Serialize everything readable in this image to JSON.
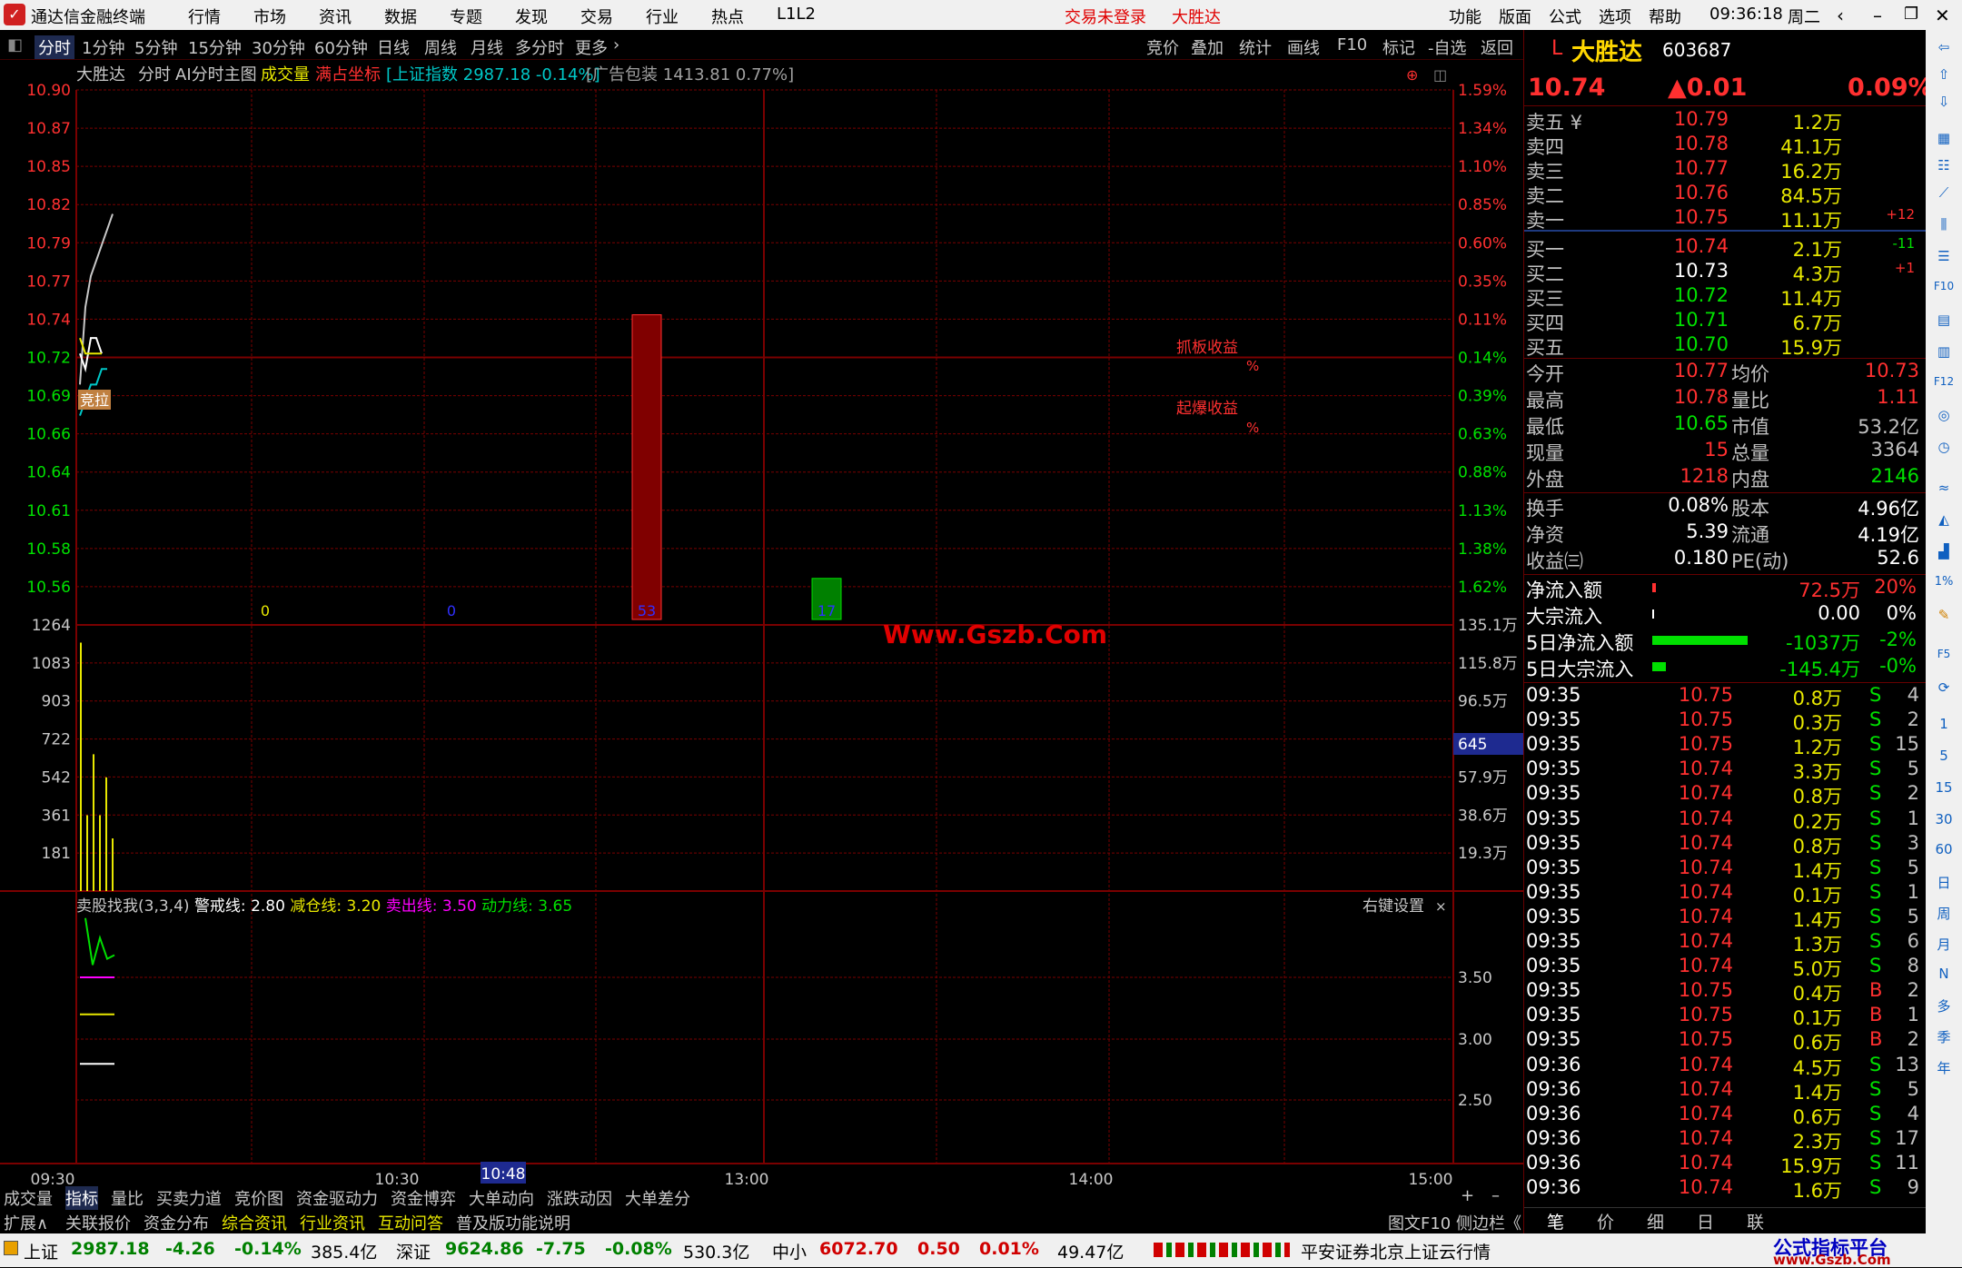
{
  "titlebar": {
    "app_name": "通达信金融终端",
    "menus": [
      "行情",
      "市场",
      "资讯",
      "数据",
      "专题",
      "发现",
      "交易",
      "行业",
      "热点",
      "L1L2"
    ],
    "login_status": "交易未登录",
    "stock_name": "大胜达",
    "right_menus": [
      "功能",
      "版面",
      "公式",
      "选项",
      "帮助"
    ],
    "clock": "09:36:18",
    "weekday": "周二"
  },
  "toolbar": {
    "periods": [
      "分时",
      "1分钟",
      "5分钟",
      "15分钟",
      "30分钟",
      "60分钟",
      "日线",
      "周线",
      "月线",
      "多分时",
      "更多"
    ],
    "right": [
      "竞价",
      "叠加",
      "统计",
      "画线",
      "F10",
      "标记",
      "-自选",
      "返回"
    ]
  },
  "chart_header": {
    "name": "大胜达",
    "mode": "分时",
    "main": "AI分时主图",
    "vol": "成交量",
    "coord": "满占坐标",
    "index": "[上证指数 2987.18 -0.14%]",
    "ad": "[广告包装 1413.81 0.77%]"
  },
  "colors": {
    "up": "#ff3030",
    "down": "#00e000",
    "grid": "#7a0000",
    "bg": "#000000"
  },
  "chart_data": [
    {
      "type": "line",
      "title": "分时",
      "price_ticks": [
        "10.90",
        "10.87",
        "10.85",
        "10.82",
        "10.79",
        "10.77",
        "10.74",
        "10.72",
        "10.69",
        "10.66",
        "10.64",
        "10.61",
        "10.58",
        "10.56"
      ],
      "pct_ticks": [
        "1.59%",
        "1.34%",
        "1.10%",
        "0.85%",
        "0.60%",
        "0.35%",
        "0.11%",
        "0.14%",
        "0.39%",
        "0.63%",
        "0.88%",
        "1.13%",
        "1.38%",
        "1.62%"
      ],
      "ylim": [
        10.555,
        10.9
      ],
      "prev_close": 10.73,
      "time_ticks": [
        "09:30",
        "10:30",
        "13:00",
        "14:00",
        "15:00"
      ],
      "cursor_time": "10:48",
      "series": [
        {
          "values": [
            10.71,
            10.76,
            10.78,
            10.79,
            10.8,
            10.81,
            10.82
          ]
        },
        {
          "values": [
            10.73,
            10.72,
            10.74,
            10.74,
            10.73
          ]
        },
        {
          "values": [
            10.74,
            10.73,
            10.73,
            10.73,
            10.73
          ]
        },
        {
          "values": [
            10.69,
            10.7,
            10.71,
            10.71,
            10.72,
            10.72
          ]
        }
      ],
      "bars": [
        {
          "label": "0",
          "value": 0,
          "color": "#e8e800"
        },
        {
          "label": "0",
          "value": 0,
          "color": "#3030ff"
        },
        {
          "label": "53",
          "value": 10.755,
          "color": "#800000"
        },
        {
          "label": "17",
          "value": 10.585,
          "color": "#008000"
        }
      ],
      "annotations": [
        "竞拉",
        "抓板收益",
        "%",
        "起爆收益",
        "%"
      ]
    },
    {
      "type": "bar",
      "title": "成交量",
      "yticks": [
        "1264",
        "1083",
        "903",
        "722",
        "542",
        "361",
        "181"
      ],
      "yticks_right": [
        "135.1万",
        "115.8万",
        "96.5万",
        "57.9万",
        "38.6万",
        "19.3万"
      ],
      "cursor_value": "645",
      "values": [
        1180,
        360,
        650,
        360,
        540,
        250
      ]
    },
    {
      "type": "line",
      "title": "卖股找我(3,3,4)",
      "legend": [
        {
          "name": "警戒线:",
          "value": "2.80",
          "color": "#ffffff"
        },
        {
          "name": "减仓线:",
          "value": "3.20",
          "color": "#e8e800"
        },
        {
          "name": "卖出线:",
          "value": "3.50",
          "color": "#ff00ff"
        },
        {
          "name": "动力线:",
          "value": "3.65",
          "color": "#00e000"
        }
      ],
      "yticks": [
        "3.50",
        "3.00",
        "2.50"
      ],
      "series": [
        {
          "name": "动力线",
          "values": [
            3.98,
            3.6,
            3.82,
            3.65,
            3.68
          ]
        }
      ],
      "right_label": "右键设置"
    }
  ],
  "watermark": "Www.Gszb.Com",
  "quote": {
    "prefix": "L",
    "name": "大胜达",
    "code": "603687",
    "price": "10.74",
    "change": "▲0.01",
    "pct": "0.09%",
    "sells": [
      {
        "label": "卖五",
        "price": "10.79",
        "vol": "1.2万",
        "chg": ""
      },
      {
        "label": "卖四",
        "price": "10.78",
        "vol": "41.1万",
        "chg": ""
      },
      {
        "label": "卖三",
        "price": "10.77",
        "vol": "16.2万",
        "chg": ""
      },
      {
        "label": "卖二",
        "price": "10.76",
        "vol": "84.5万",
        "chg": ""
      },
      {
        "label": "卖一",
        "price": "10.75",
        "vol": "11.1万",
        "chg": "+12"
      }
    ],
    "buys": [
      {
        "label": "买一",
        "price": "10.74",
        "vol": "2.1万",
        "chg": "-11"
      },
      {
        "label": "买二",
        "price": "10.73",
        "vol": "4.3万",
        "chg": "+1"
      },
      {
        "label": "买三",
        "price": "10.72",
        "vol": "11.4万",
        "chg": ""
      },
      {
        "label": "买四",
        "price": "10.71",
        "vol": "6.7万",
        "chg": ""
      },
      {
        "label": "买五",
        "price": "10.70",
        "vol": "15.9万",
        "chg": ""
      }
    ],
    "stats": [
      {
        "l": "今开",
        "v": "10.77",
        "l2": "均价",
        "v2": "10.73"
      },
      {
        "l": "最高",
        "v": "10.78",
        "l2": "量比",
        "v2": "1.11"
      },
      {
        "l": "最低",
        "v": "10.65",
        "l2": "市值",
        "v2": "53.2亿"
      },
      {
        "l": "现量",
        "v": "15",
        "l2": "总量",
        "v2": "3364"
      },
      {
        "l": "外盘",
        "v": "1218",
        "l2": "内盘",
        "v2": "2146"
      }
    ],
    "stats2": [
      {
        "l": "换手",
        "v": "0.08%",
        "l2": "股本",
        "v2": "4.96亿"
      },
      {
        "l": "净资",
        "v": "5.39",
        "l2": "流通",
        "v2": "4.19亿"
      },
      {
        "l": "收益㈢",
        "v": "0.180",
        "l2": "PE(动)",
        "v2": "52.6"
      }
    ],
    "flows": [
      {
        "l": "净流入额",
        "v": "72.5万",
        "p": "20%",
        "bar": 0.02,
        "color": "#ff3030"
      },
      {
        "l": "大宗流入",
        "v": "0.00",
        "p": "0%",
        "bar": 0.005,
        "color": "#ffffff"
      },
      {
        "l": "5日净流入额",
        "v": "-1037万",
        "p": "-2%",
        "bar": 0.55,
        "color": "#00e000"
      },
      {
        "l": "5日大宗流入",
        "v": "-145.4万",
        "p": "-0%",
        "bar": 0.08,
        "color": "#00e000"
      }
    ],
    "ticks": [
      [
        "09:35",
        "10.75",
        "0.8万",
        "S",
        "4"
      ],
      [
        "09:35",
        "10.75",
        "0.3万",
        "S",
        "2"
      ],
      [
        "09:35",
        "10.75",
        "1.2万",
        "S",
        "15"
      ],
      [
        "09:35",
        "10.74",
        "3.3万",
        "S",
        "5"
      ],
      [
        "09:35",
        "10.74",
        "0.8万",
        "S",
        "2"
      ],
      [
        "09:35",
        "10.74",
        "0.2万",
        "S",
        "1"
      ],
      [
        "09:35",
        "10.74",
        "0.8万",
        "S",
        "3"
      ],
      [
        "09:35",
        "10.74",
        "1.4万",
        "S",
        "5"
      ],
      [
        "09:35",
        "10.74",
        "0.1万",
        "S",
        "1"
      ],
      [
        "09:35",
        "10.74",
        "1.4万",
        "S",
        "5"
      ],
      [
        "09:35",
        "10.74",
        "1.3万",
        "S",
        "6"
      ],
      [
        "09:35",
        "10.74",
        "5.0万",
        "S",
        "8"
      ],
      [
        "09:35",
        "10.75",
        "0.4万",
        "B",
        "2"
      ],
      [
        "09:35",
        "10.75",
        "0.1万",
        "B",
        "1"
      ],
      [
        "09:35",
        "10.75",
        "0.6万",
        "B",
        "2"
      ],
      [
        "09:36",
        "10.74",
        "4.5万",
        "S",
        "13"
      ],
      [
        "09:36",
        "10.74",
        "1.4万",
        "S",
        "5"
      ],
      [
        "09:36",
        "10.74",
        "0.6万",
        "S",
        "4"
      ],
      [
        "09:36",
        "10.74",
        "2.3万",
        "S",
        "17"
      ],
      [
        "09:36",
        "10.74",
        "15.9万",
        "S",
        "11"
      ],
      [
        "09:36",
        "10.74",
        "1.6万",
        "S",
        "9"
      ]
    ],
    "tabs": [
      "笔",
      "价",
      "细",
      "日",
      "联"
    ]
  },
  "bottom": {
    "tabs1": [
      "成交量",
      "指标",
      "量比",
      "买卖力道",
      "竞价图",
      "资金驱动力",
      "资金博弈",
      "大单动向",
      "涨跌动因",
      "大单差分"
    ],
    "tabs2": [
      "扩展∧",
      "关联报价",
      "资金分布",
      "综合资讯",
      "行业资讯",
      "互动问答",
      "普及版功能说明"
    ],
    "right": "图文F10 侧边栏《"
  },
  "status": {
    "sh_label": "上证",
    "sh": "2987.18",
    "sh_chg": "-4.26",
    "sh_pct": "-0.14%",
    "sh_amt": "385.4亿",
    "sz_label": "深证",
    "sz": "9624.86",
    "sz_chg": "-7.75",
    "sz_pct": "-0.08%",
    "sz_amt": "530.3亿",
    "zx_label": "中小",
    "zx": "6072.70",
    "zx_chg": "0.50",
    "zx_pct": "0.01%",
    "zx_amt": "49.47亿",
    "broker": "平安证券北京上证云行情",
    "logo_text": "公式指标平台",
    "logo_url": "www.Gszb.Com"
  },
  "sidebar_icons": [
    "1",
    "5",
    "15",
    "30",
    "60",
    "日",
    "周",
    "月",
    "N",
    "多",
    "季",
    "年"
  ]
}
